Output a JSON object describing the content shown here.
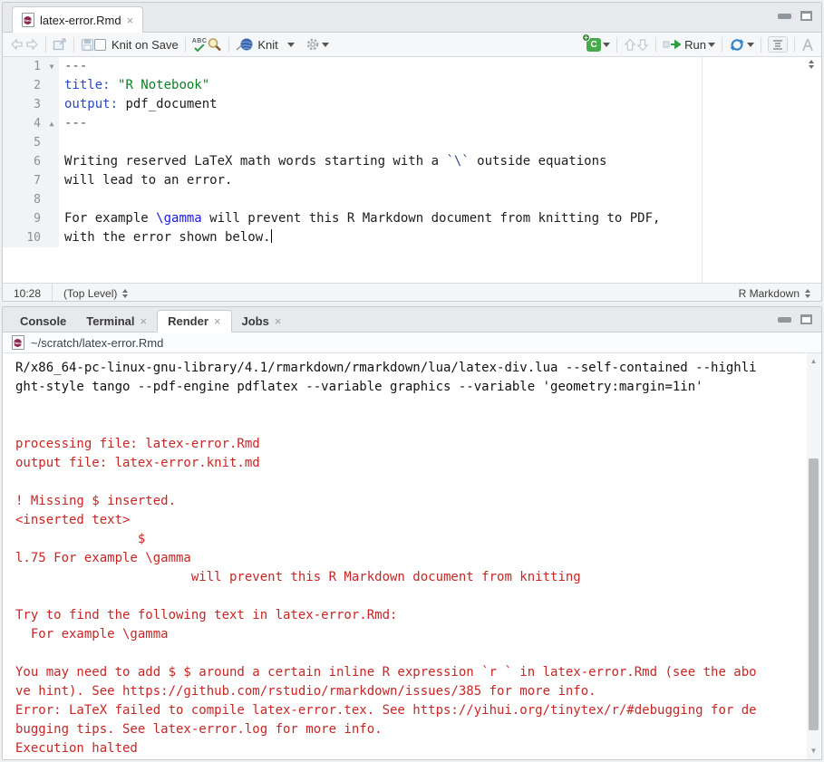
{
  "colors": {
    "error_red": "#c62626",
    "yaml_key_blue": "#2949c9",
    "string_green": "#0b7f25",
    "tex_command_blue": "#1a1ae6",
    "knit_yarn_blue": "#3a66b0",
    "run_arrow_green": "#2e9e44",
    "rmd_badge_maroon": "#8e2950",
    "chunk_badge_green": "#49a94d"
  },
  "icons": {
    "close": "×",
    "dropdown_caret": "▾",
    "fold_open": "▼",
    "fold_close": "▲",
    "scroll_up": "▲",
    "scroll_down": "▼",
    "plus": "+",
    "spellcheck_letters": "ABC",
    "chunk_letter": "C"
  },
  "editor_pane": {
    "tab_label": "latex-error.Rmd",
    "toolbar": {
      "knit_on_save": "Knit on Save",
      "knit": "Knit",
      "run": "Run"
    },
    "lines": [
      {
        "num": "1",
        "fold": "fold_open",
        "segments": [
          {
            "c": "tok-delim",
            "t": "---"
          }
        ]
      },
      {
        "num": "2",
        "fold": "",
        "segments": [
          {
            "c": "tok-key",
            "t": "title:"
          },
          {
            "c": "",
            "t": " "
          },
          {
            "c": "tok-string",
            "t": "\"R Notebook\""
          }
        ]
      },
      {
        "num": "3",
        "fold": "",
        "segments": [
          {
            "c": "tok-key",
            "t": "output:"
          },
          {
            "c": "",
            "t": " pdf_document"
          }
        ]
      },
      {
        "num": "4",
        "fold": "fold_close",
        "segments": [
          {
            "c": "tok-delim",
            "t": "---"
          }
        ]
      },
      {
        "num": "5",
        "fold": "",
        "segments": []
      },
      {
        "num": "6",
        "fold": "",
        "segments": [
          {
            "c": "",
            "t": "Writing reserved LaTeX math words starting with a "
          },
          {
            "c": "tok-code",
            "t": "`\\`"
          },
          {
            "c": "",
            "t": " outside equations"
          }
        ]
      },
      {
        "num": "7",
        "fold": "",
        "segments": [
          {
            "c": "",
            "t": "will lead to an error."
          }
        ]
      },
      {
        "num": "8",
        "fold": "",
        "segments": []
      },
      {
        "num": "9",
        "fold": "",
        "segments": [
          {
            "c": "",
            "t": "For example "
          },
          {
            "c": "tok-tex",
            "t": "\\gamma"
          },
          {
            "c": "",
            "t": " will prevent this R Markdown document from knitting to PDF,"
          }
        ]
      },
      {
        "num": "10",
        "fold": "",
        "segments": [
          {
            "c": "",
            "t": "with the error shown below."
          }
        ],
        "cursor": true
      }
    ],
    "status": {
      "cursor_position": "10:28",
      "scope": "(Top Level)",
      "mode": "R Markdown"
    }
  },
  "bottom_pane": {
    "tabs": [
      {
        "label": "Console",
        "closable": false,
        "active": false
      },
      {
        "label": "Terminal",
        "closable": true,
        "active": false
      },
      {
        "label": "Render",
        "closable": true,
        "active": true
      },
      {
        "label": "Jobs",
        "closable": true,
        "active": false
      }
    ],
    "file_path": "~/scratch/latex-error.Rmd",
    "console_lines": [
      {
        "c": "plain",
        "t": "R/x86_64-pc-linux-gnu-library/4.1/rmarkdown/rmarkdown/lua/latex-div.lua --self-contained --highli"
      },
      {
        "c": "plain",
        "t": "ght-style tango --pdf-engine pdflatex --variable graphics --variable 'geometry:margin=1in'"
      },
      {
        "c": "plain",
        "t": ""
      },
      {
        "c": "plain",
        "t": ""
      },
      {
        "c": "err",
        "t": "processing file: latex-error.Rmd"
      },
      {
        "c": "err",
        "t": "output file: latex-error.knit.md"
      },
      {
        "c": "plain",
        "t": ""
      },
      {
        "c": "err",
        "t": "! Missing $ inserted."
      },
      {
        "c": "err",
        "t": "<inserted text>"
      },
      {
        "c": "err",
        "t": "                $"
      },
      {
        "c": "err",
        "t": "l.75 For example \\gamma"
      },
      {
        "c": "err",
        "t": "                       will prevent this R Markdown document from knitting"
      },
      {
        "c": "plain",
        "t": ""
      },
      {
        "c": "err",
        "t": "Try to find the following text in latex-error.Rmd:"
      },
      {
        "c": "err",
        "t": "  For example \\gamma"
      },
      {
        "c": "plain",
        "t": ""
      },
      {
        "c": "err",
        "t": "You may need to add $ $ around a certain inline R expression `r ` in latex-error.Rmd (see the abo"
      },
      {
        "c": "err",
        "t": "ve hint). See https://github.com/rstudio/rmarkdown/issues/385 for more info."
      },
      {
        "c": "err",
        "t": "Error: LaTeX failed to compile latex-error.tex. See https://yihui.org/tinytex/r/#debugging for de"
      },
      {
        "c": "err",
        "t": "bugging tips. See latex-error.log for more info."
      },
      {
        "c": "err",
        "t": "Execution halted"
      }
    ]
  }
}
